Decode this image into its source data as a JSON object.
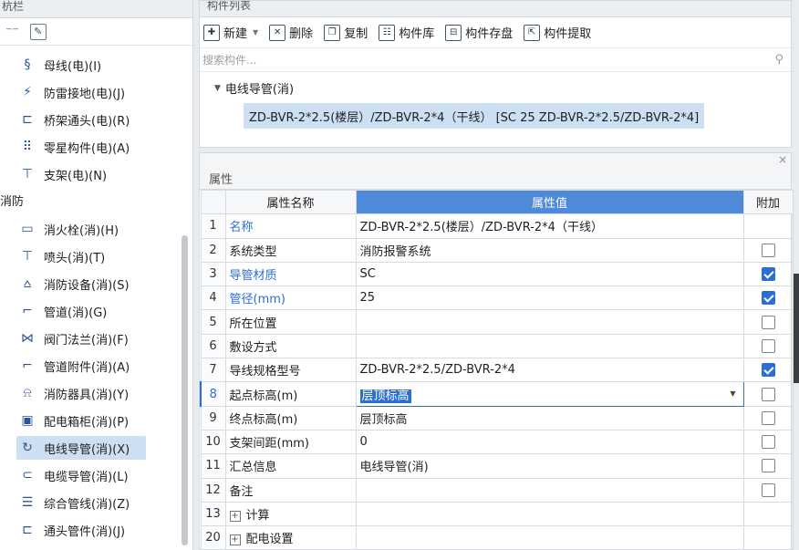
{
  "nav": {
    "header": "杭栏",
    "items": [
      {
        "label": "母线(电)(I)",
        "icon": "bus-icon"
      },
      {
        "label": "防雷接地(电)(J)",
        "icon": "lightning-ground-icon"
      },
      {
        "label": "桥架通头(电)(R)",
        "icon": "tray-joint-icon"
      },
      {
        "label": "零星构件(电)(A)",
        "icon": "grid-dots-icon"
      },
      {
        "label": "支架(电)(N)",
        "icon": "bracket-icon"
      }
    ],
    "group": "消防",
    "fire_items": [
      {
        "label": "消火栓(消)(H)",
        "icon": "hydrant-icon"
      },
      {
        "label": "喷头(消)(T)",
        "icon": "sprinkler-icon"
      },
      {
        "label": "消防设备(消)(S)",
        "icon": "fire-equipment-icon"
      },
      {
        "label": "管道(消)(G)",
        "icon": "pipe-icon"
      },
      {
        "label": "阀门法兰(消)(F)",
        "icon": "valve-icon"
      },
      {
        "label": "管道附件(消)(A)",
        "icon": "pipe-fitting-icon"
      },
      {
        "label": "消防器具(消)(Y)",
        "icon": "fire-device-icon"
      },
      {
        "label": "配电箱柜(消)(P)",
        "icon": "distribution-box-icon"
      },
      {
        "label": "电线导管(消)(X)",
        "icon": "conduit-icon"
      },
      {
        "label": "电缆导管(消)(L)",
        "icon": "cable-conduit-icon"
      },
      {
        "label": "综合管线(消)(Z)",
        "icon": "combined-pipeline-icon"
      },
      {
        "label": "通头管件(消)(J)",
        "icon": "joint-fitting-icon"
      }
    ]
  },
  "component_list": {
    "title": "构件列表",
    "toolbar": {
      "new": "新建",
      "delete": "删除",
      "copy": "复制",
      "library": "构件库",
      "save": "构件存盘",
      "extract": "构件提取"
    },
    "search_placeholder": "搜索构件...",
    "tree_parent": "电线导管(消)",
    "tree_child": "ZD-BVR-2*2.5(楼层）/ZD-BVR-2*4（干线） [SC 25 ZD-BVR-2*2.5/ZD-BVR-2*4]"
  },
  "properties": {
    "title": "属性",
    "headers": {
      "name": "属性名称",
      "value": "属性值",
      "extra": "附加"
    },
    "rows": [
      {
        "num": "1",
        "name": "名称",
        "value": "ZD-BVR-2*2.5(楼层）/ZD-BVR-2*4（干线）",
        "blue": true,
        "check": null
      },
      {
        "num": "2",
        "name": "系统类型",
        "value": "消防报警系统",
        "blue": false,
        "check": false
      },
      {
        "num": "3",
        "name": "导管材质",
        "value": "SC",
        "blue": true,
        "check": true
      },
      {
        "num": "4",
        "name": "管径(mm)",
        "value": "25",
        "blue": true,
        "check": true
      },
      {
        "num": "5",
        "name": "所在位置",
        "value": "",
        "blue": false,
        "check": false
      },
      {
        "num": "6",
        "name": "敷设方式",
        "value": "",
        "blue": false,
        "check": false
      },
      {
        "num": "7",
        "name": "导线规格型号",
        "value": "ZD-BVR-2*2.5/ZD-BVR-2*4",
        "blue": false,
        "check": true
      },
      {
        "num": "8",
        "name": "起点标高(m)",
        "value": "层顶标高",
        "blue": false,
        "check": false
      },
      {
        "num": "9",
        "name": "终点标高(m)",
        "value": "层顶标高",
        "blue": false,
        "check": false
      },
      {
        "num": "10",
        "name": "支架间距(mm)",
        "value": "0",
        "blue": false,
        "check": false
      },
      {
        "num": "11",
        "name": "汇总信息",
        "value": "电线导管(消)",
        "blue": false,
        "check": false
      },
      {
        "num": "12",
        "name": "备注",
        "value": "",
        "blue": false,
        "check": false
      },
      {
        "num": "13",
        "name": "计算",
        "value": "",
        "blue": false,
        "check": null
      },
      {
        "num": "20",
        "name": "配电设置",
        "value": "",
        "blue": false,
        "check": null
      }
    ]
  }
}
